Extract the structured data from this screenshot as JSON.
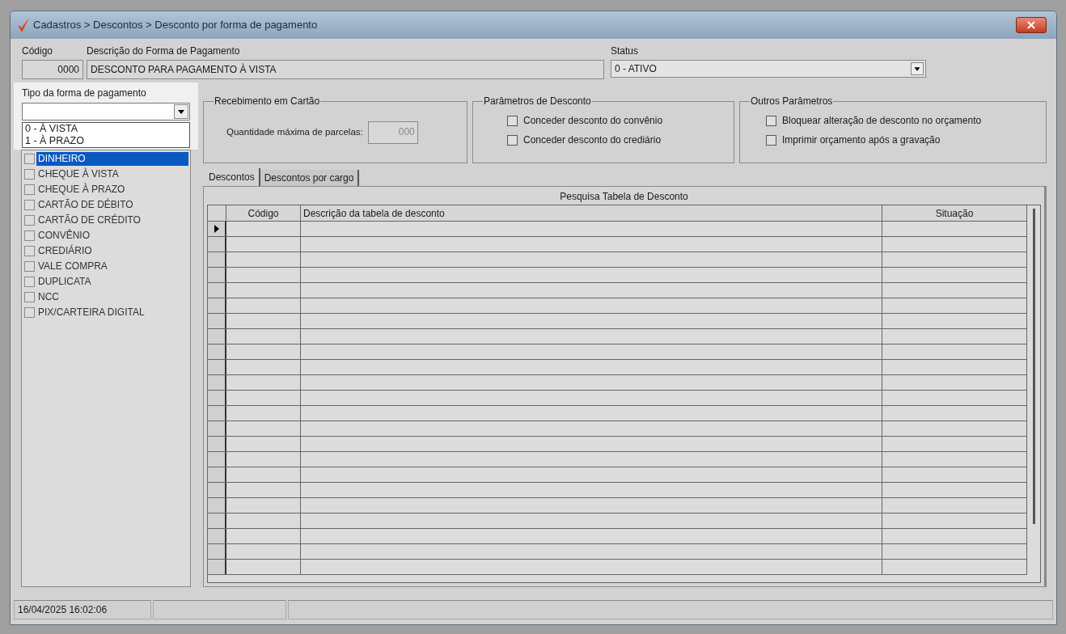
{
  "window": {
    "title": "Cadastros > Descontos > Desconto por forma de pagamento"
  },
  "header": {
    "code_label": "Código",
    "code": "0000",
    "description_label": "Descrição do Forma de Pagamento",
    "description": "DESCONTO PARA PAGAMENTO À VISTA",
    "status_label": "Status",
    "status": "0 - ATIVO"
  },
  "payment_type": {
    "label": "Tipo da forma de pagamento",
    "options": [
      {
        "label": "0 - À VISTA"
      },
      {
        "label": "1 - À PRAZO"
      }
    ]
  },
  "payment_methods": [
    {
      "label": "DINHEIRO",
      "checked": false,
      "selected": true
    },
    {
      "label": "CHEQUE À VISTA",
      "checked": false,
      "selected": false
    },
    {
      "label": "CHEQUE À PRAZO",
      "checked": false,
      "selected": false
    },
    {
      "label": "CARTÃO DE DÉBITO",
      "checked": false,
      "selected": false
    },
    {
      "label": "CARTÃO DE CRÉDITO",
      "checked": false,
      "selected": false
    },
    {
      "label": "CONVÊNIO",
      "checked": false,
      "selected": false
    },
    {
      "label": "CREDIÁRIO",
      "checked": false,
      "selected": false
    },
    {
      "label": "VALE COMPRA",
      "checked": false,
      "selected": false
    },
    {
      "label": "DUPLICATA",
      "checked": false,
      "selected": false
    },
    {
      "label": "NCC",
      "checked": false,
      "selected": false
    },
    {
      "label": "PIX/CARTEIRA DIGITAL",
      "checked": false,
      "selected": false
    }
  ],
  "card_group": {
    "title": "Recebimento em Cartão",
    "installments_label": "Quantidade máxima de parcelas:",
    "installments": "000"
  },
  "discount_params": {
    "title": "Parâmetros de Desconto",
    "options": [
      {
        "label": "Conceder desconto do convênio",
        "checked": false
      },
      {
        "label": "Conceder desconto do crediário",
        "checked": false
      }
    ]
  },
  "other_params": {
    "title": "Outros Parâmetros",
    "options": [
      {
        "label": "Bloquear alteração de desconto no orçamento",
        "checked": false
      },
      {
        "label": "Imprimir orçamento após a gravação",
        "checked": false
      }
    ]
  },
  "tabs": [
    {
      "label": "Descontos",
      "selected": true
    },
    {
      "label": "Descontos por cargo",
      "selected": false
    }
  ],
  "table": {
    "title": "Pesquisa Tabela de Desconto",
    "columns": [
      "Código",
      "Descrição da tabela de desconto",
      "Situação"
    ],
    "rows": [
      {
        "current": true
      },
      {
        "current": false
      },
      {
        "current": false
      },
      {
        "current": false
      },
      {
        "current": false
      },
      {
        "current": false
      },
      {
        "current": false
      },
      {
        "current": false
      },
      {
        "current": false
      },
      {
        "current": false
      },
      {
        "current": false
      },
      {
        "current": false
      },
      {
        "current": false
      },
      {
        "current": false
      },
      {
        "current": false
      },
      {
        "current": false
      },
      {
        "current": false
      },
      {
        "current": false
      },
      {
        "current": false
      },
      {
        "current": false
      },
      {
        "current": false
      },
      {
        "current": false
      },
      {
        "current": false
      }
    ]
  },
  "status_bar": {
    "datetime": "16/04/2025 16:02:06"
  }
}
